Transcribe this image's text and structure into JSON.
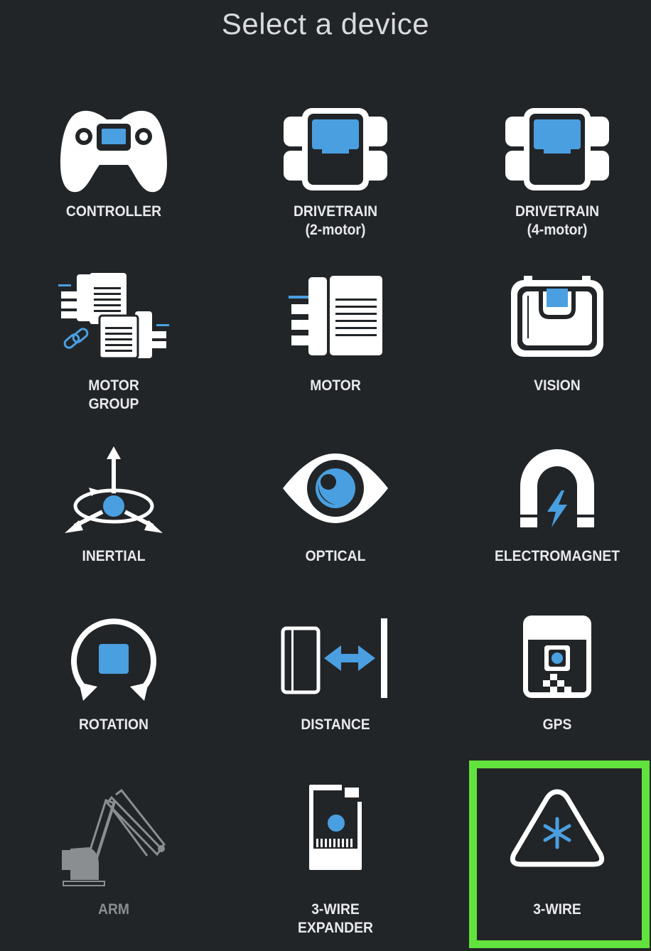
{
  "title": "Select a device",
  "devices": [
    {
      "label": "CONTROLLER",
      "icon": "controller-icon"
    },
    {
      "label": "DRIVETRAIN\n(2-motor)",
      "icon": "drivetrain-2-motor-icon"
    },
    {
      "label": "DRIVETRAIN\n(4-motor)",
      "icon": "drivetrain-4-motor-icon"
    },
    {
      "label": "MOTOR\nGROUP",
      "icon": "motor-group-icon"
    },
    {
      "label": "MOTOR",
      "icon": "motor-icon"
    },
    {
      "label": "VISION",
      "icon": "vision-sensor-icon"
    },
    {
      "label": "INERTIAL",
      "icon": "inertial-sensor-icon"
    },
    {
      "label": "OPTICAL",
      "icon": "optical-sensor-icon"
    },
    {
      "label": "ELECTROMAGNET",
      "icon": "electromagnet-icon"
    },
    {
      "label": "ROTATION",
      "icon": "rotation-sensor-icon"
    },
    {
      "label": "DISTANCE",
      "icon": "distance-sensor-icon"
    },
    {
      "label": "GPS",
      "icon": "gps-sensor-icon"
    },
    {
      "label": "ARM",
      "icon": "arm-icon",
      "disabled": true
    },
    {
      "label": "3-WIRE\nEXPANDER",
      "icon": "three-wire-expander-icon"
    },
    {
      "label": "3-WIRE",
      "icon": "three-wire-icon",
      "selected": true
    }
  ],
  "colors": {
    "background": "#222528",
    "icon": "#ffffff",
    "accent": "#4a9fe0",
    "selection": "#62e23c",
    "disabled": "#8b8e91"
  }
}
